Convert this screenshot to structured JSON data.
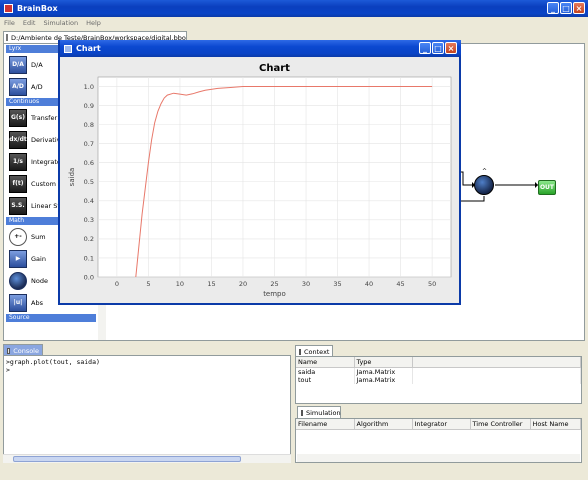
{
  "app": {
    "title": "BrainBox",
    "menu": [
      "File",
      "Edit",
      "Simulation",
      "Help"
    ],
    "editor_tab": "D:/Ambiente de Teste/BrainBox/workspace/digital.bbox",
    "editor_tab_close": "×"
  },
  "palette": {
    "categories": [
      {
        "label": "Lyrx",
        "items": [
          {
            "icon": "D/A",
            "label": "D/A",
            "icon_name": "digital-analog-icon"
          },
          {
            "icon": "A/D",
            "label": "A/D",
            "icon_name": "analog-digital-icon"
          }
        ]
      },
      {
        "label": "Continuos",
        "items": [
          {
            "icon": "G(s)",
            "label": "Transfer F",
            "icon_name": "transfer-function-icon"
          },
          {
            "icon": "dx/dt",
            "label": "Derivative",
            "icon_name": "derivative-icon"
          },
          {
            "icon": "1/s",
            "label": "Integrator",
            "icon_name": "integrator-icon"
          },
          {
            "icon": "f(t)",
            "label": "Custom St",
            "icon_name": "custom-state-icon"
          },
          {
            "icon": "S.S.",
            "label": "Linear Sta",
            "icon_name": "linear-state-icon"
          }
        ]
      },
      {
        "label": "Math",
        "items": [
          {
            "icon": "+-",
            "label": "Sum",
            "icon_name": "sum-icon"
          },
          {
            "icon": "▶",
            "label": "Gain",
            "icon_name": "gain-icon"
          },
          {
            "icon": "",
            "label": "Node",
            "icon_name": "node-icon"
          },
          {
            "icon": "|u|",
            "label": "Abs",
            "icon_name": "abs-icon"
          }
        ]
      },
      {
        "label": "Source",
        "items": []
      }
    ]
  },
  "diagram": {
    "out_block_label": "OUT",
    "node_sign": "^"
  },
  "chart_window": {
    "title": "Chart"
  },
  "chart_data": {
    "type": "line",
    "title": "Chart",
    "xlabel": "tempo",
    "ylabel": "saida",
    "xlim": [
      -3,
      53
    ],
    "ylim": [
      0,
      1.05
    ],
    "xticks": [
      0,
      5,
      10,
      15,
      20,
      25,
      30,
      35,
      40,
      45,
      50
    ],
    "yticks": [
      0.0,
      0.1,
      0.2,
      0.3,
      0.4,
      0.5,
      0.6,
      0.7,
      0.8,
      0.9,
      1.0
    ],
    "grid": true,
    "line_color": "#e8786a",
    "series": [
      {
        "x": [
          3,
          4,
          5,
          5.5,
          6,
          6.5,
          7,
          7.5,
          8,
          9,
          10,
          11,
          12,
          13,
          14,
          16,
          18,
          20,
          25,
          30,
          40,
          50
        ],
        "y": [
          0.0,
          0.33,
          0.6,
          0.72,
          0.81,
          0.87,
          0.91,
          0.94,
          0.955,
          0.965,
          0.96,
          0.955,
          0.962,
          0.972,
          0.98,
          0.99,
          0.995,
          1.0,
          1.0,
          1.0,
          1.0,
          1.0
        ]
      }
    ]
  },
  "console": {
    "tab_label": "Console",
    "lines": [
      ">graph.plot(tout, saida)",
      ">"
    ]
  },
  "context": {
    "tab_label": "Context",
    "columns": [
      "Name",
      "Type"
    ],
    "rows": [
      {
        "name": "saida",
        "type": "Jama.Matrix"
      },
      {
        "name": "tout",
        "type": "Jama.Matrix"
      }
    ]
  },
  "simulation": {
    "tab_label": "Simulation",
    "columns": [
      "Filename",
      "Algorithm",
      "Integrator",
      "Time Controller",
      "Host Name"
    ]
  }
}
